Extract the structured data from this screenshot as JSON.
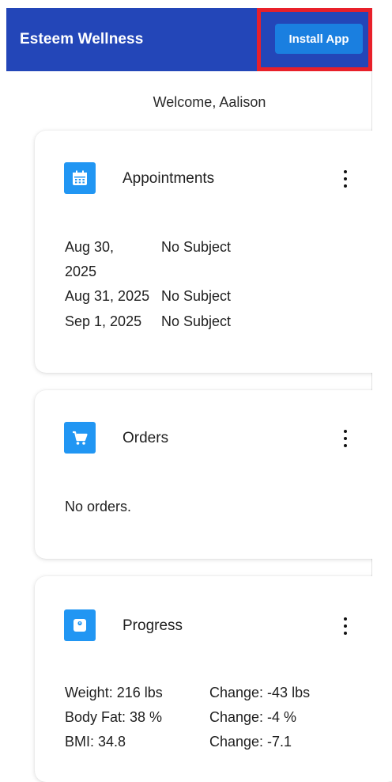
{
  "app": {
    "title": "Esteem Wellness",
    "install_label": "Install App"
  },
  "welcome": "Welcome, Aalison",
  "appointments": {
    "title": "Appointments",
    "icon": "calendar-icon",
    "items": [
      {
        "date": "Aug 30, 2025",
        "subject": "No Subject"
      },
      {
        "date": "Aug 31, 2025",
        "subject": "No Subject"
      },
      {
        "date": "Sep 1, 2025",
        "subject": "No Subject"
      }
    ]
  },
  "orders": {
    "title": "Orders",
    "icon": "cart-icon",
    "empty_text": "No orders."
  },
  "progress": {
    "title": "Progress",
    "icon": "scale-icon",
    "rows": [
      {
        "metric": "Weight: 216 lbs",
        "change": "Change: -43 lbs"
      },
      {
        "metric": "Body Fat: 38 %",
        "change": "Change: -4 %"
      },
      {
        "metric": "BMI: 34.8",
        "change": "Change: -7.1"
      }
    ]
  },
  "colors": {
    "appbar": "#2346b8",
    "button": "#1a7fe0",
    "icon_tile": "#2196f3",
    "highlight": "#e8202a"
  }
}
